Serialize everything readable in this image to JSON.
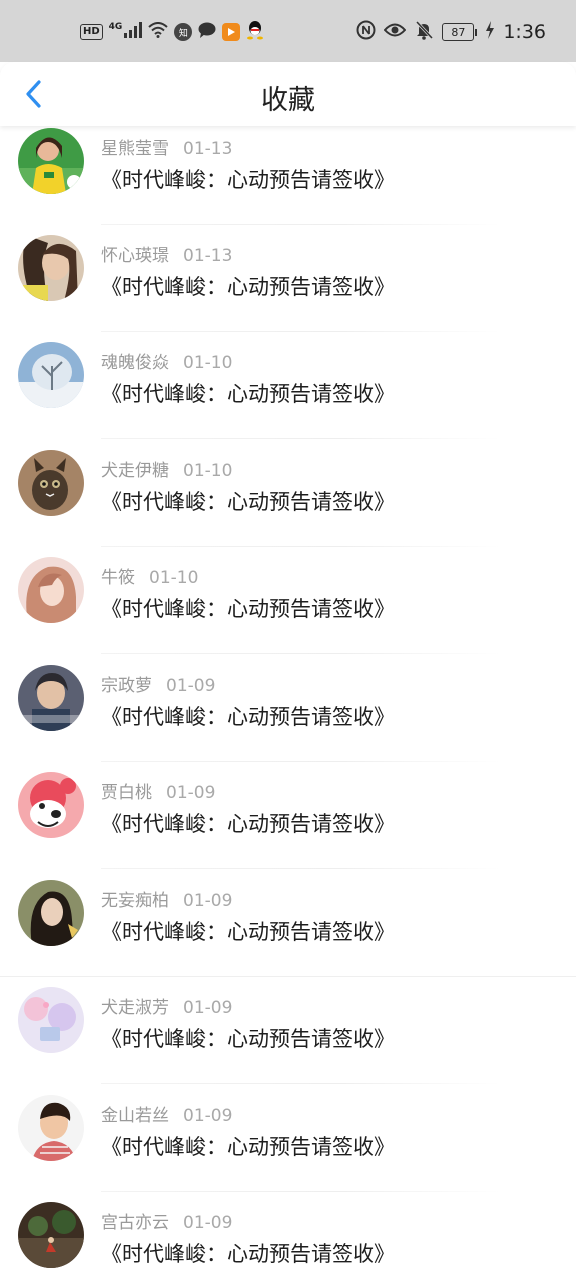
{
  "status_bar": {
    "left_icons": [
      "hd-icon",
      "signal-4g-icon",
      "wifi-icon",
      "zhihu-icon",
      "message-icon",
      "video-app-icon",
      "qq-icon"
    ],
    "hd_label": "HD",
    "network_label": "4G",
    "zhihu_label": "知",
    "right_icons": [
      "nfc-icon",
      "eye-icon",
      "bell-off-icon",
      "battery-icon",
      "charging-icon"
    ],
    "battery": "87",
    "time": "1:36"
  },
  "nav": {
    "title": "收藏",
    "accent_color": "#2f8ff0"
  },
  "favorites": [
    {
      "name": "星熊莹雪",
      "date": "01-13",
      "title": "《时代峰峻：心动预告请签收》",
      "avatar": "avatar-photo"
    },
    {
      "name": "怀心瑛璟",
      "date": "01-13",
      "title": "《时代峰峻：心动预告请签收》",
      "avatar": "avatar-photo"
    },
    {
      "name": "魂魄俊焱",
      "date": "01-10",
      "title": "《时代峰峻：心动预告请签收》",
      "avatar": "avatar-photo"
    },
    {
      "name": "犬走伊糖",
      "date": "01-10",
      "title": "《时代峰峻：心动预告请签收》",
      "avatar": "avatar-photo"
    },
    {
      "name": "牛筱",
      "date": "01-10",
      "title": "《时代峰峻：心动预告请签收》",
      "avatar": "avatar-photo"
    },
    {
      "name": "宗政萝",
      "date": "01-09",
      "title": "《时代峰峻：心动预告请签收》",
      "avatar": "avatar-photo"
    },
    {
      "name": "贾白桃",
      "date": "01-09",
      "title": "《时代峰峻：心动预告请签收》",
      "avatar": "avatar-cartoon"
    },
    {
      "name": "无妄痴柏",
      "date": "01-09",
      "title": "《时代峰峻：心动预告请签收》",
      "avatar": "avatar-photo"
    },
    {
      "name": "犬走淑芳",
      "date": "01-09",
      "title": "《时代峰峻：心动预告请签收》",
      "avatar": "avatar-illustration"
    },
    {
      "name": "金山若丝",
      "date": "01-09",
      "title": "《时代峰峻：心动预告请签收》",
      "avatar": "avatar-photo"
    },
    {
      "name": "宫古亦云",
      "date": "01-09",
      "title": "《时代峰峻：心动预告请签收》",
      "avatar": "avatar-photo"
    }
  ]
}
